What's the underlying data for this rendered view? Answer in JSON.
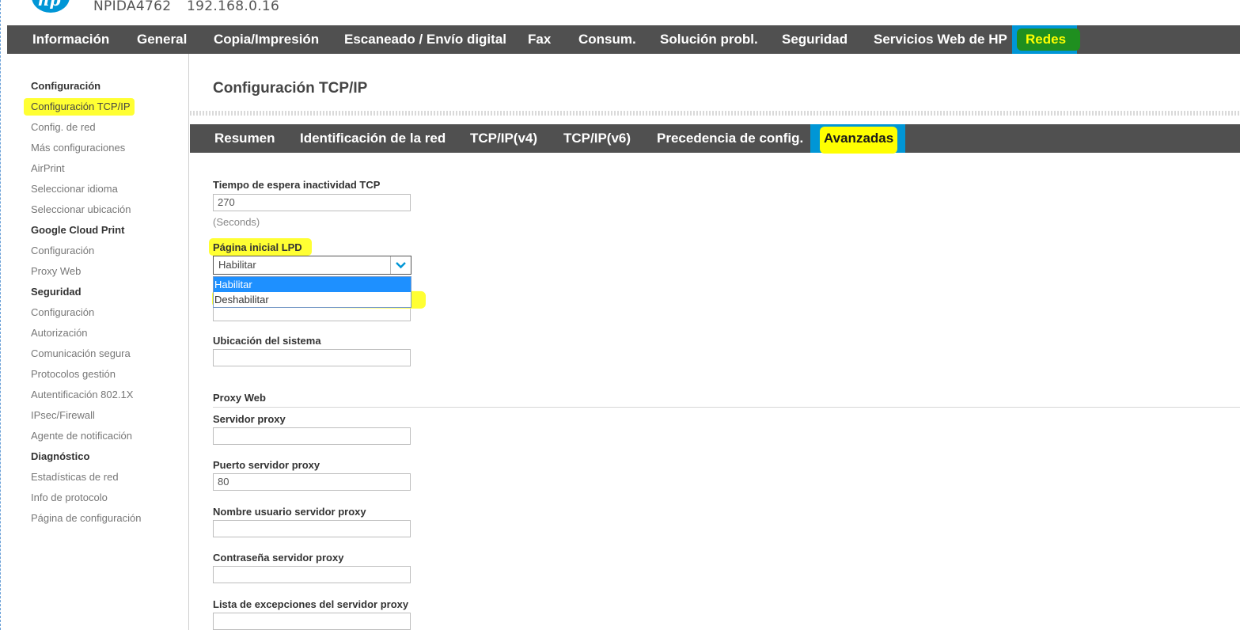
{
  "header": {
    "logo_text": "hp",
    "device_name": "NPIDA4762",
    "device_ip": "192.168.0.16"
  },
  "top_nav": {
    "items": [
      "Información",
      "General",
      "Copia/Impresión",
      "Escaneado / Envío digital",
      "Fax",
      "Consum.",
      "Solución probl.",
      "Seguridad",
      "Servicios Web de HP",
      "Redes"
    ],
    "active": "Redes"
  },
  "sidebar": {
    "items": [
      {
        "label": "Configuración",
        "heading": true
      },
      {
        "label": "Configuración TCP/IP",
        "selected": true
      },
      {
        "label": "Config. de red"
      },
      {
        "label": "Más configuraciones"
      },
      {
        "label": "AirPrint"
      },
      {
        "label": "Seleccionar idioma"
      },
      {
        "label": "Seleccionar ubicación"
      },
      {
        "label": "Google Cloud Print",
        "heading": true
      },
      {
        "label": "Configuración"
      },
      {
        "label": "Proxy Web"
      },
      {
        "label": "Seguridad",
        "heading": true
      },
      {
        "label": "Configuración"
      },
      {
        "label": "Autorización"
      },
      {
        "label": "Comunicación segura"
      },
      {
        "label": "Protocolos gestión"
      },
      {
        "label": "Autentificación 802.1X"
      },
      {
        "label": "IPsec/Firewall"
      },
      {
        "label": "Agente de notificación"
      },
      {
        "label": "Diagnóstico",
        "heading": true
      },
      {
        "label": "Estadísticas de red"
      },
      {
        "label": "Info de protocolo"
      },
      {
        "label": "Página de configuración"
      }
    ]
  },
  "main": {
    "page_title": "Configuración TCP/IP",
    "sub_tabs": [
      "Resumen",
      "Identificación de la red",
      "TCP/IP(v4)",
      "TCP/IP(v6)",
      "Precedencia de config.",
      "Avanzadas"
    ],
    "active_sub_tab": "Avanzadas",
    "tcp_idle_timeout": {
      "label": "Tiempo de espera inactividad TCP",
      "value": "270",
      "hint": "(Seconds)"
    },
    "lpd_banner": {
      "label": "Página inicial LPD",
      "value": "Habilitar",
      "options": [
        "Habilitar",
        "Deshabilitar"
      ]
    },
    "system_location": {
      "label": "Ubicación del sistema",
      "value": ""
    },
    "proxy_section_title": "Proxy Web",
    "proxy_server": {
      "label": "Servidor proxy",
      "value": ""
    },
    "proxy_port": {
      "label": "Puerto servidor proxy",
      "value": "80"
    },
    "proxy_user": {
      "label": "Nombre usuario servidor proxy",
      "value": ""
    },
    "proxy_password": {
      "label": "Contraseña servidor proxy",
      "value": ""
    },
    "proxy_exceptions": {
      "label": "Lista de excepciones del servidor proxy",
      "value": ""
    }
  },
  "colors": {
    "nav_bg": "#505050",
    "active_tab_bg": "#0096d6",
    "highlight_yellow": "#ffff33",
    "highlight_green": "#1f8f1f",
    "dropdown_hover": "#1e90ff"
  }
}
